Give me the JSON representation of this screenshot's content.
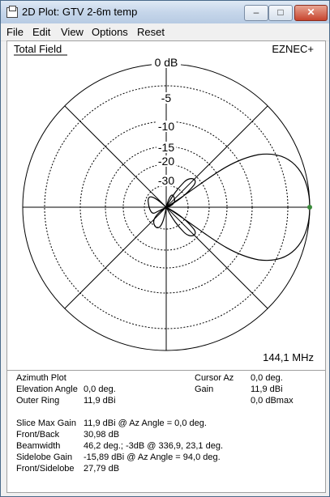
{
  "window": {
    "title": "2D Plot: GTV 2-6m temp",
    "controls": {
      "minimize": "–",
      "maximize": "□",
      "close": "✕"
    }
  },
  "menu": {
    "items": [
      "File",
      "Edit",
      "View",
      "Options",
      "Reset"
    ]
  },
  "plot": {
    "field_label": "Total Field",
    "brand": "EZNEC+",
    "frequency": "144,1 MHz",
    "ring_labels": [
      "0 dB",
      "-5",
      "-10",
      "-15",
      "-20",
      "-30"
    ],
    "colors": {
      "pattern": "#000000",
      "cursor_dot": "#3a8a3a"
    }
  },
  "info": {
    "plot_type": "Azimuth Plot",
    "elevation_label": "Elevation Angle",
    "elevation_value": "0,0 deg.",
    "outer_ring_label": "Outer Ring",
    "outer_ring_value": "11,9 dBi",
    "cursor_az_label": "Cursor Az",
    "cursor_az_value": "0,0 deg.",
    "gain_label": "Gain",
    "gain_value": "11,9 dBi",
    "gain_max_value": "0,0 dBmax",
    "slice_max_label": "Slice Max Gain",
    "slice_max_value": "11,9 dBi @ Az Angle = 0,0 deg.",
    "front_back_label": "Front/Back",
    "front_back_value": "30,98 dB",
    "beamwidth_label": "Beamwidth",
    "beamwidth_value": "46,2 deg.; -3dB @ 336,9, 23,1 deg.",
    "sidelobe_gain_label": "Sidelobe Gain",
    "sidelobe_gain_value": "-15,89 dBi @ Az Angle = 94,0 deg.",
    "front_sidelobe_label": "Front/Sidelobe",
    "front_sidelobe_value": "27,79 dB"
  }
}
